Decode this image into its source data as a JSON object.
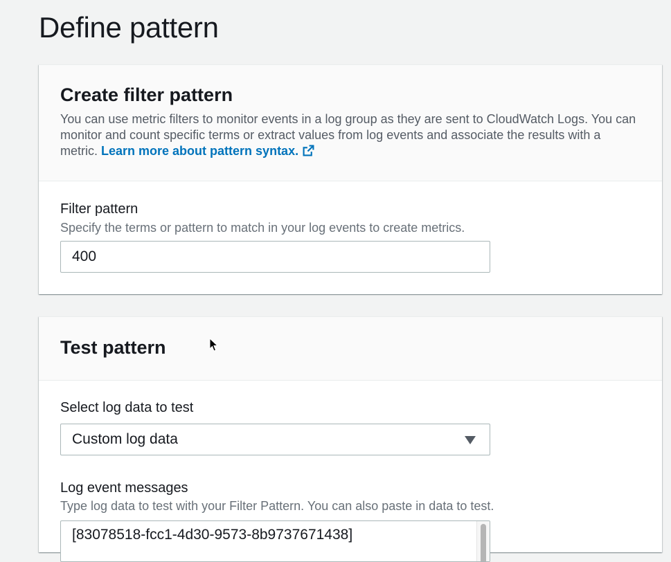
{
  "page": {
    "title": "Define pattern"
  },
  "create_panel": {
    "title": "Create filter pattern",
    "description": "You can use metric filters to monitor events in a log group as they are sent to CloudWatch Logs. You can monitor and count specific terms or extract values from log events and associate the results with a metric.",
    "link_label": "Learn more about pattern syntax.",
    "link_icon": "external-link-icon",
    "filter_label": "Filter pattern",
    "filter_hint": "Specify the terms or pattern to match in your log events to create metrics.",
    "filter_value": "400"
  },
  "test_panel": {
    "title": "Test pattern",
    "select_label": "Select log data to test",
    "select_value": "Custom log data",
    "select_icon": "caret-down-icon",
    "messages_label": "Log event messages",
    "messages_hint": "Type log data to test with your Filter Pattern. You can also paste in data to test.",
    "messages_first_line": "[83078518-fcc1-4d30-9573-8b9737671438]"
  },
  "colors": {
    "background": "#f2f3f3",
    "link": "#0073bb",
    "text": "#16191f",
    "muted": "#545b64"
  }
}
